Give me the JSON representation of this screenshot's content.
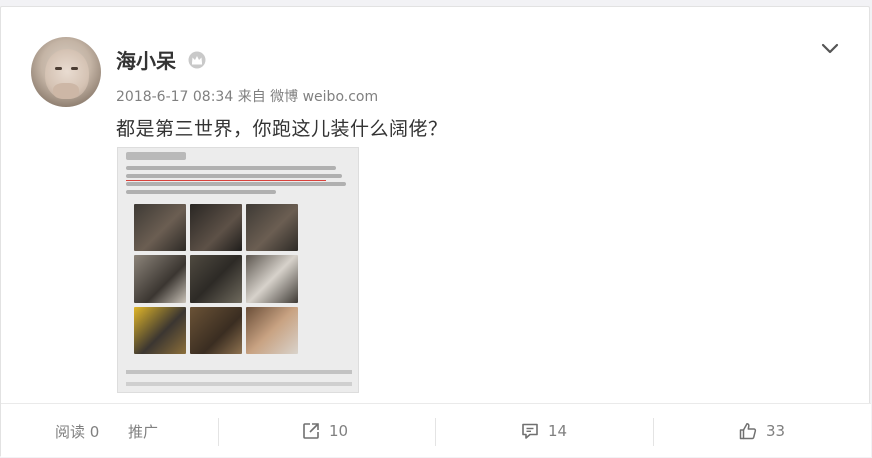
{
  "post": {
    "username": "海小呆",
    "meta": "2018-6-17 08:34 来自 微博 weibo.com",
    "text": "都是第三世界，你跑这儿装什么阔佬？"
  },
  "icons": {
    "avatar": "avatar-photo",
    "vip": "crown-icon",
    "menu": "chevron-down-icon",
    "forward": "share-icon",
    "comment": "comment-icon",
    "like": "thumbs-up-icon"
  },
  "actions": {
    "read_label": "阅读 0",
    "promote_label": "推广",
    "forward_count": "10",
    "comment_count": "14",
    "like_count": "33"
  }
}
